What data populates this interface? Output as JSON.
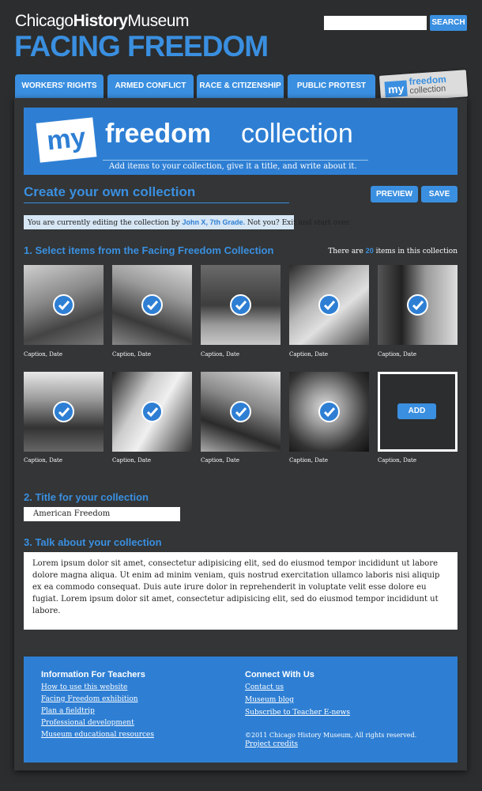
{
  "header": {
    "museum_prefix": "Chicago",
    "museum_bold": "History",
    "museum_suffix": "Museum",
    "site_title": "FACING FREEDOM",
    "search_placeholder": "",
    "search_label": "SEARCH"
  },
  "tabs": [
    {
      "label": "WORKERS' RIGHTS"
    },
    {
      "label": "ARMED CONFLICT"
    },
    {
      "label": "RACE & CITIZENSHIP"
    },
    {
      "label": "PUBLIC PROTEST"
    }
  ],
  "my_tab": {
    "my": "my",
    "freedom": "freedom",
    "collection": "collection"
  },
  "banner": {
    "my": "my",
    "freedom": "freedom",
    "collection": "collection",
    "subtitle": "Add items to your collection, give it a title, and write about it."
  },
  "create": {
    "heading": "Create your own collection",
    "preview_label": "PREVIEW",
    "save_label": "SAVE"
  },
  "editing": {
    "prefix": "You are currently editing the collection by ",
    "user": "John X, 7th Grade.",
    "suffix": " Not you? Exit and start over."
  },
  "section1": {
    "heading": "1. Select items from the Facing Freedom Collection",
    "count_prefix": "There are ",
    "count": "20",
    "count_suffix": " items in this collection"
  },
  "items": [
    {
      "caption": "Caption, Date",
      "selected": true
    },
    {
      "caption": "Caption, Date",
      "selected": true
    },
    {
      "caption": "Caption, Date",
      "selected": true
    },
    {
      "caption": "Caption, Date",
      "selected": true
    },
    {
      "caption": "Caption, Date",
      "selected": true
    },
    {
      "caption": "Caption, Date",
      "selected": true
    },
    {
      "caption": "Caption, Date",
      "selected": true
    },
    {
      "caption": "Caption, Date",
      "selected": true
    },
    {
      "caption": "Caption, Date",
      "selected": true
    }
  ],
  "add_item": {
    "label": "ADD",
    "caption": "Caption, Date"
  },
  "section2": {
    "heading": "2. Title for your collection",
    "value": "American Freedom"
  },
  "section3": {
    "heading": "3. Talk about your collection",
    "value": "Lorem ipsum dolor sit amet, consectetur adipisicing elit, sed do eiusmod tempor incididunt ut labore dolore magna aliqua. Ut enim ad minim veniam, quis nostrud exercitation ullamco laboris nisi aliquip ex ea commodo consequat. Duis aute irure dolor in reprehenderit in voluptate velit esse dolore eu fugiat. Lorem ipsum dolor sit amet, consectetur adipisicing elit, sed do eiusmod tempor incididunt ut labore."
  },
  "footer": {
    "teachers_heading": "Information For Teachers",
    "teachers_links": [
      "How to use this website",
      "Facing Freedom exhibition",
      "Plan a fieldtrip",
      "Professional development",
      "Museum educational resources"
    ],
    "connect_heading": "Connect With Us",
    "connect_links": [
      "Contact us",
      "Museum blog",
      "Subscribe to Teacher E-news"
    ],
    "copyright": "©2011 Chicago History Museum, All rights reserved.",
    "credits": "Project credits"
  },
  "colors": {
    "accent": "#3a8fe0",
    "banner": "#2e7fd4",
    "background": "#2b2d2e"
  }
}
